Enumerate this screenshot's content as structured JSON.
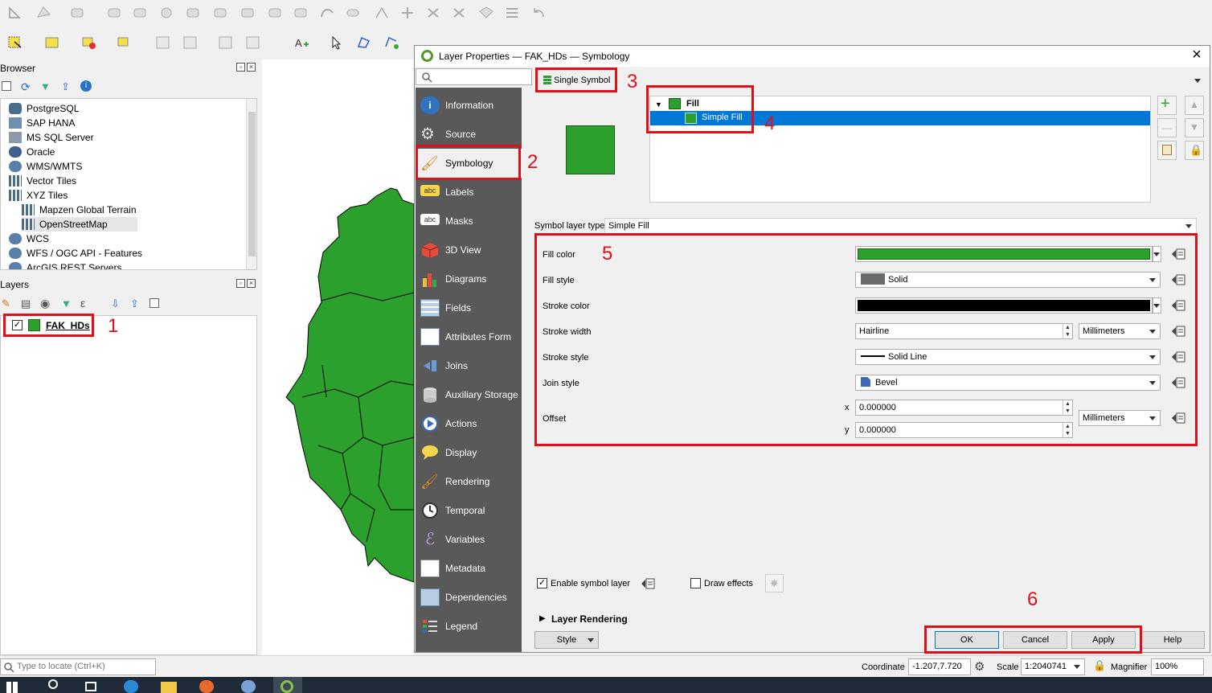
{
  "browser": {
    "title": "Browser",
    "items": [
      "PostgreSQL",
      "SAP HANA",
      "MS SQL Server",
      "Oracle",
      "WMS/WMTS",
      "Vector Tiles",
      "XYZ Tiles",
      "Mapzen Global Terrain",
      "OpenStreetMap",
      "WCS",
      "WFS / OGC API - Features",
      "ArcGIS REST Servers"
    ]
  },
  "layers": {
    "title": "Layers",
    "layer_name": "FAK_HDs"
  },
  "dialog": {
    "title": "Layer Properties — FAK_HDs — Symbology",
    "close_label": "×",
    "sidebar": [
      "Information",
      "Source",
      "Symbology",
      "Labels",
      "Masks",
      "3D View",
      "Diagrams",
      "Fields",
      "Attributes Form",
      "Joins",
      "Auxiliary Storage",
      "Actions",
      "Display",
      "Rendering",
      "Temporal",
      "Variables",
      "Metadata",
      "Dependencies",
      "Legend"
    ],
    "renderer": "Single Symbol",
    "tree_root": "Fill",
    "tree_child": "Simple Fill",
    "symbol_layer_type_label": "Symbol layer type",
    "symbol_layer_type": "Simple Fill",
    "fill_color_label": "Fill color",
    "fill_style_label": "Fill style",
    "fill_style": "Solid",
    "stroke_color_label": "Stroke color",
    "stroke_width_label": "Stroke width",
    "stroke_width": "Hairline",
    "stroke_width_unit": "Millimeters",
    "stroke_style_label": "Stroke style",
    "stroke_style": "Solid Line",
    "join_style_label": "Join style",
    "join_style": "Bevel",
    "offset_label": "Offset",
    "offset_x_label": "x",
    "offset_y_label": "y",
    "offset_x": "0.000000",
    "offset_y": "0.000000",
    "offset_unit": "Millimeters",
    "enable_symbol_layer": "Enable symbol layer",
    "draw_effects": "Draw effects",
    "layer_rendering": "Layer Rendering",
    "style_button": "Style",
    "ok": "OK",
    "cancel": "Cancel",
    "apply": "Apply",
    "help": "Help"
  },
  "colors": {
    "fill": "#2ca02c",
    "stroke": "#000000",
    "accent_red": "#e0101b",
    "selection": "#0078d7"
  },
  "annotations": [
    "1",
    "2",
    "3",
    "4",
    "5",
    "6"
  ],
  "statusbar": {
    "locate_placeholder": "Type to locate (Ctrl+K)",
    "coordinate_label": "Coordinate",
    "coordinate": "-1.207,7.720",
    "scale_label": "Scale",
    "scale": "1:2040741",
    "magnifier_label": "Magnifier",
    "magnifier": "100%"
  }
}
